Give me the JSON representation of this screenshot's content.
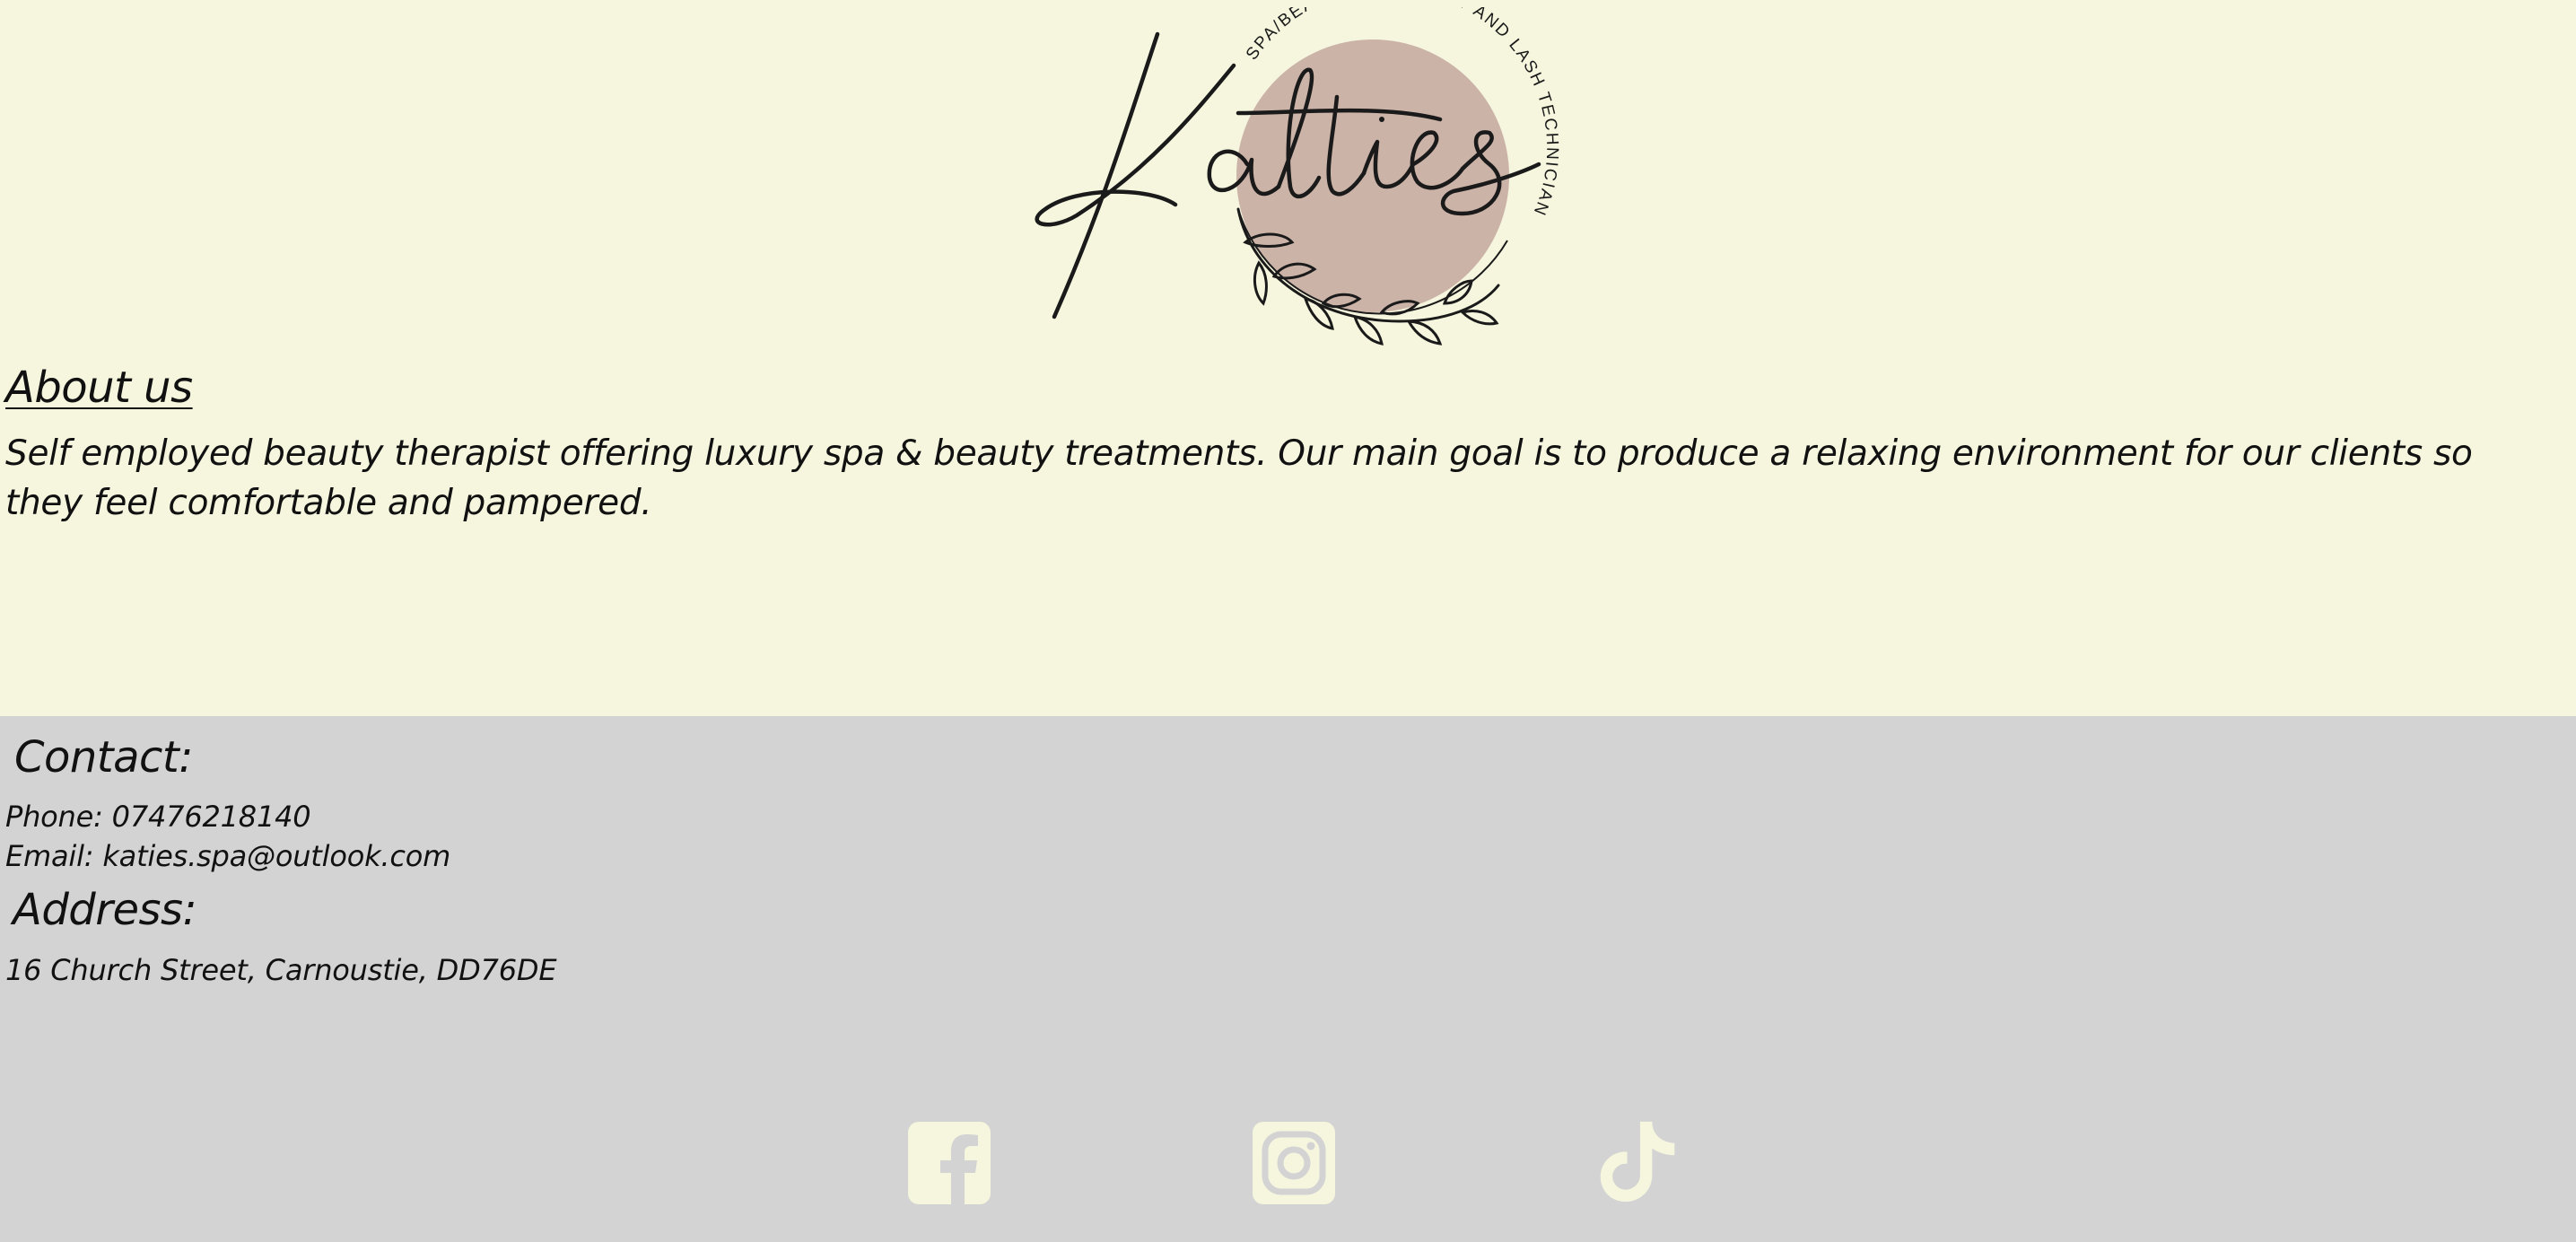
{
  "logo": {
    "script_text": "Katies",
    "arc_text": "SPA/BEAUTY THERAPIST AND LASH TECHNICIAN",
    "circle_color": "#CBB3A8",
    "ink_color": "#1A1A1A"
  },
  "about": {
    "heading": "About us",
    "text": "Self employed beauty therapist offering luxury spa & beauty treatments. Our main goal is to produce a relaxing environment for our clients so they feel comfortable and pampered."
  },
  "contact": {
    "heading": "Contact:",
    "phone": "Phone: 07476218140",
    "email": "Email: katies.spa@outlook.com"
  },
  "address": {
    "heading": "Address:",
    "line": "16 Church Street, Carnoustie, DD76DE"
  },
  "social": [
    {
      "icon": "facebook-icon"
    },
    {
      "icon": "instagram-icon"
    },
    {
      "icon": "tiktok-icon"
    }
  ],
  "colors": {
    "page_background": "#F6F6DF",
    "footer_background": "#D3D3D3",
    "social_icon": "#F6F6DF",
    "text": "#111111"
  }
}
